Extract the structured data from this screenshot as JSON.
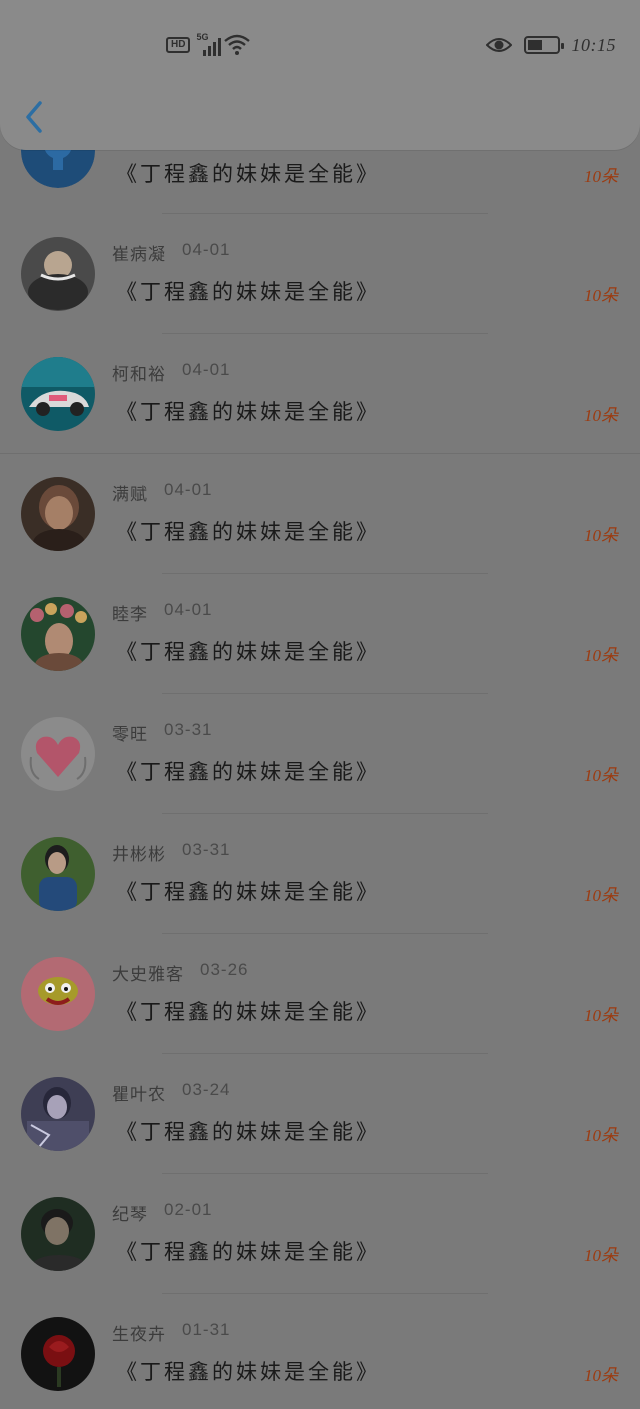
{
  "status": {
    "hd": "HD",
    "network": "5G",
    "time": "10:15"
  },
  "header": {
    "back_icon": "chevron-left-icon"
  },
  "items": [
    {
      "name": "",
      "date": "",
      "title": "《丁程鑫的妹妹是全能》",
      "gift": "10朵",
      "avatar": "blue-avatar"
    },
    {
      "name": "崔病凝",
      "date": "04-01",
      "title": "《丁程鑫的妹妹是全能》",
      "gift": "10朵",
      "avatar": "man-avatar"
    },
    {
      "name": "柯和裕",
      "date": "04-01",
      "title": "《丁程鑫的妹妹是全能》",
      "gift": "10朵",
      "avatar": "car-avatar"
    },
    {
      "name": "满赋",
      "date": "04-01",
      "title": "《丁程鑫的妹妹是全能》",
      "gift": "10朵",
      "avatar": "woman-avatar"
    },
    {
      "name": "睦李",
      "date": "04-01",
      "title": "《丁程鑫的妹妹是全能》",
      "gift": "10朵",
      "avatar": "flowers-avatar"
    },
    {
      "name": "零旺",
      "date": "03-31",
      "title": "《丁程鑫的妹妹是全能》",
      "gift": "10朵",
      "avatar": "heart-avatar"
    },
    {
      "name": "井彬彬",
      "date": "03-31",
      "title": "《丁程鑫的妹妹是全能》",
      "gift": "10朵",
      "avatar": "girl-avatar"
    },
    {
      "name": "大史雅客",
      "date": "03-26",
      "title": "《丁程鑫的妹妹是全能》",
      "gift": "10朵",
      "avatar": "monkey-avatar"
    },
    {
      "name": "瞿叶农",
      "date": "03-24",
      "title": "《丁程鑫的妹妹是全能》",
      "gift": "10朵",
      "avatar": "anime-avatar"
    },
    {
      "name": "纪琴",
      "date": "02-01",
      "title": "《丁程鑫的妹妹是全能》",
      "gift": "10朵",
      "avatar": "boy-avatar"
    },
    {
      "name": "生夜卉",
      "date": "01-31",
      "title": "《丁程鑫的妹妹是全能》",
      "gift": "10朵",
      "avatar": "rose-avatar"
    }
  ]
}
